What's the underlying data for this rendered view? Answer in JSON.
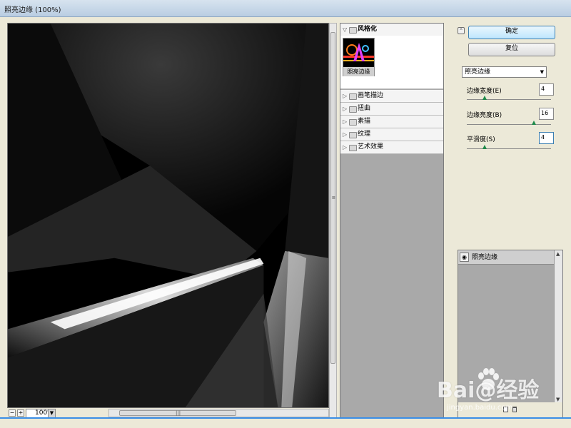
{
  "window": {
    "title": "照亮边缘 (100%)"
  },
  "preview": {
    "zoom": "100%"
  },
  "filter_gallery": {
    "categories": [
      {
        "label": "风格化",
        "expanded": true,
        "filters": [
          {
            "label": "照亮边缘",
            "selected": true
          }
        ]
      },
      {
        "label": "画笔描边",
        "expanded": false
      },
      {
        "label": "扭曲",
        "expanded": false
      },
      {
        "label": "素描",
        "expanded": false
      },
      {
        "label": "纹理",
        "expanded": false
      },
      {
        "label": "艺术效果",
        "expanded": false
      }
    ]
  },
  "controls": {
    "ok_label": "确定",
    "reset_label": "复位",
    "selected_filter": "照亮边缘",
    "params": [
      {
        "label": "边缘宽度(E)",
        "value": "4",
        "level": 0.21
      },
      {
        "label": "边缘亮度(B)",
        "value": "16",
        "level": 0.8
      },
      {
        "label": "平滑度(S)",
        "value": "4",
        "level": 0.21
      }
    ]
  },
  "effect_layers": [
    {
      "label": "照亮边缘"
    }
  ],
  "watermark": {
    "text": "Bai@经验",
    "url": "jingyan.baidu.com"
  },
  "colors": {
    "accent": "#3c7fb1",
    "slider_thumb": "#1e8a4a",
    "panel_gray": "#a9a9a9"
  }
}
